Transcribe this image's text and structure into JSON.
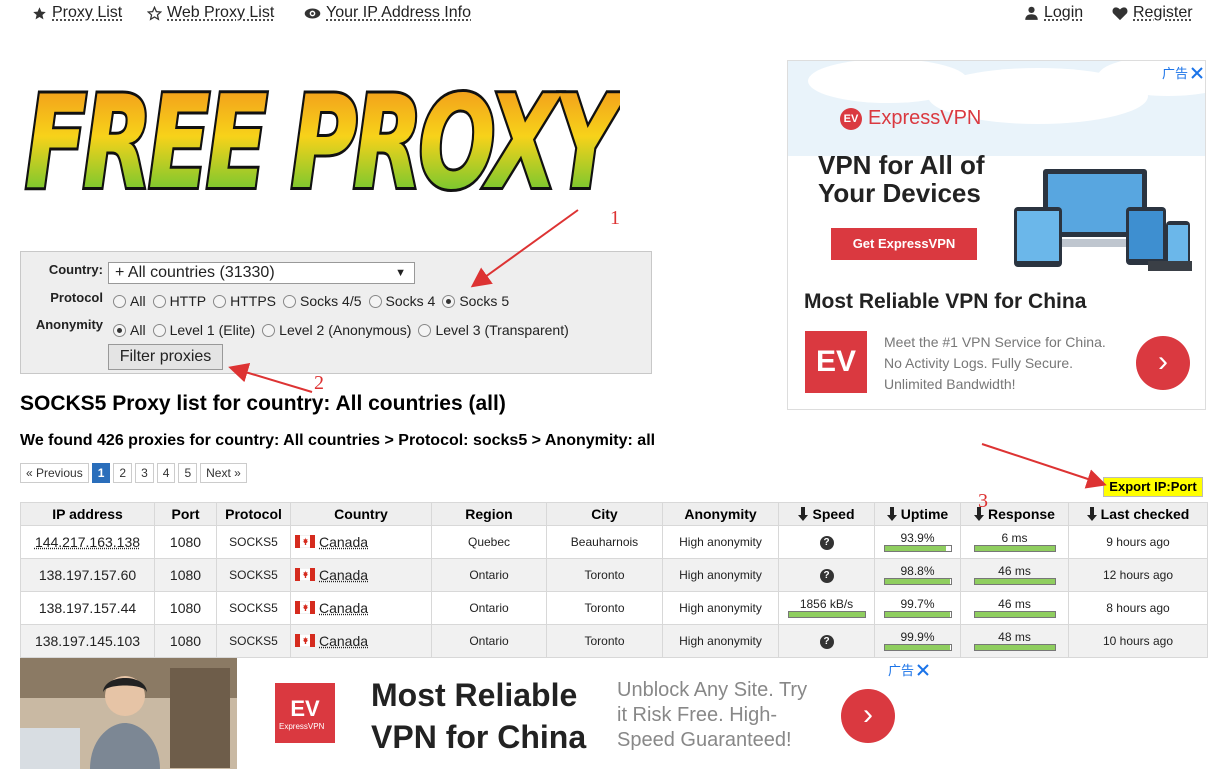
{
  "nav": {
    "proxy_list": "Proxy List",
    "web_proxy_list": "Web Proxy List",
    "ip_info": "Your IP Address Info",
    "login": "Login",
    "register": "Register"
  },
  "logo_text": "FREE PROXY",
  "filters": {
    "country_label": "Country:",
    "country_value": "+ All countries (31330)",
    "protocol_label": "Protocol",
    "protocol_options": [
      "All",
      "HTTP",
      "HTTPS",
      "Socks 4/5",
      "Socks 4",
      "Socks 5"
    ],
    "protocol_selected": "Socks 5",
    "anonymity_label": "Anonymity",
    "anonymity_options": [
      "All",
      "Level 1 (Elite)",
      "Level 2 (Anonymous)",
      "Level 3 (Transparent)"
    ],
    "anonymity_selected": "All",
    "filter_button": "Filter proxies"
  },
  "page_title": "SOCKS5 Proxy list for country: All countries (all)",
  "found_text": "We found 426 proxies for country: All countries > Protocol: socks5 > Anonymity: all",
  "pager": {
    "previous": "« Previous",
    "pages": [
      "1",
      "2",
      "3",
      "4",
      "5"
    ],
    "current": "1",
    "next": "Next »"
  },
  "export_button": "Export IP:Port",
  "table": {
    "headers": [
      "IP address",
      "Port",
      "Protocol",
      "Country",
      "Region",
      "City",
      "Anonymity",
      "Speed",
      "Uptime",
      "Response",
      "Last checked"
    ],
    "rows": [
      {
        "ip": "144.217.163.138",
        "port": "1080",
        "protocol": "SOCKS5",
        "country": "Canada",
        "region": "Quebec",
        "city": "Beauharnois",
        "anonymity": "High anonymity",
        "speed": "?",
        "uptime": "93.9%",
        "uptime_frac": 0.939,
        "response": "6 ms",
        "response_frac": 1.0,
        "last_checked": "9 hours ago"
      },
      {
        "ip": "138.197.157.60",
        "port": "1080",
        "protocol": "SOCKS5",
        "country": "Canada",
        "region": "Ontario",
        "city": "Toronto",
        "anonymity": "High anonymity",
        "speed": "?",
        "uptime": "98.8%",
        "uptime_frac": 0.988,
        "response": "46 ms",
        "response_frac": 1.0,
        "last_checked": "12 hours ago"
      },
      {
        "ip": "138.197.157.44",
        "port": "1080",
        "protocol": "SOCKS5",
        "country": "Canada",
        "region": "Ontario",
        "city": "Toronto",
        "anonymity": "High anonymity",
        "speed": "1856 kB/s",
        "uptime": "99.7%",
        "uptime_frac": 0.997,
        "response": "46 ms",
        "response_frac": 1.0,
        "last_checked": "8 hours ago"
      },
      {
        "ip": "138.197.145.103",
        "port": "1080",
        "protocol": "SOCKS5",
        "country": "Canada",
        "region": "Ontario",
        "city": "Toronto",
        "anonymity": "High anonymity",
        "speed": "?",
        "uptime": "99.9%",
        "uptime_frac": 0.999,
        "response": "48 ms",
        "response_frac": 1.0,
        "last_checked": "10 hours ago"
      }
    ]
  },
  "ad_right": {
    "ad_label": "广告",
    "brand": "ExpressVPN",
    "headline_1": "VPN for All of",
    "headline_2": "Your Devices",
    "cta": "Get ExpressVPN",
    "title": "Most Reliable VPN for China",
    "desc_1": "Meet the #1 VPN Service for China.",
    "desc_2": "No Activity Logs. Fully Secure.",
    "desc_3": "Unlimited Bandwidth!"
  },
  "ad_bottom": {
    "ad_label": "广告",
    "brand": "ExpressVPN",
    "title_1": "Most Reliable",
    "title_2": "VPN for China",
    "desc_1": "Unblock Any Site. Try",
    "desc_2": "it Risk Free. High-",
    "desc_3": "Speed Guaranteed!"
  },
  "annotations": [
    "1",
    "2",
    "3"
  ],
  "colors": {
    "accent_blue": "#2a6ebb",
    "brand_red": "#da3940",
    "bar_green": "#8fce5f",
    "export_yellow": "#ffff00",
    "annotation_red": "#dd3333"
  }
}
